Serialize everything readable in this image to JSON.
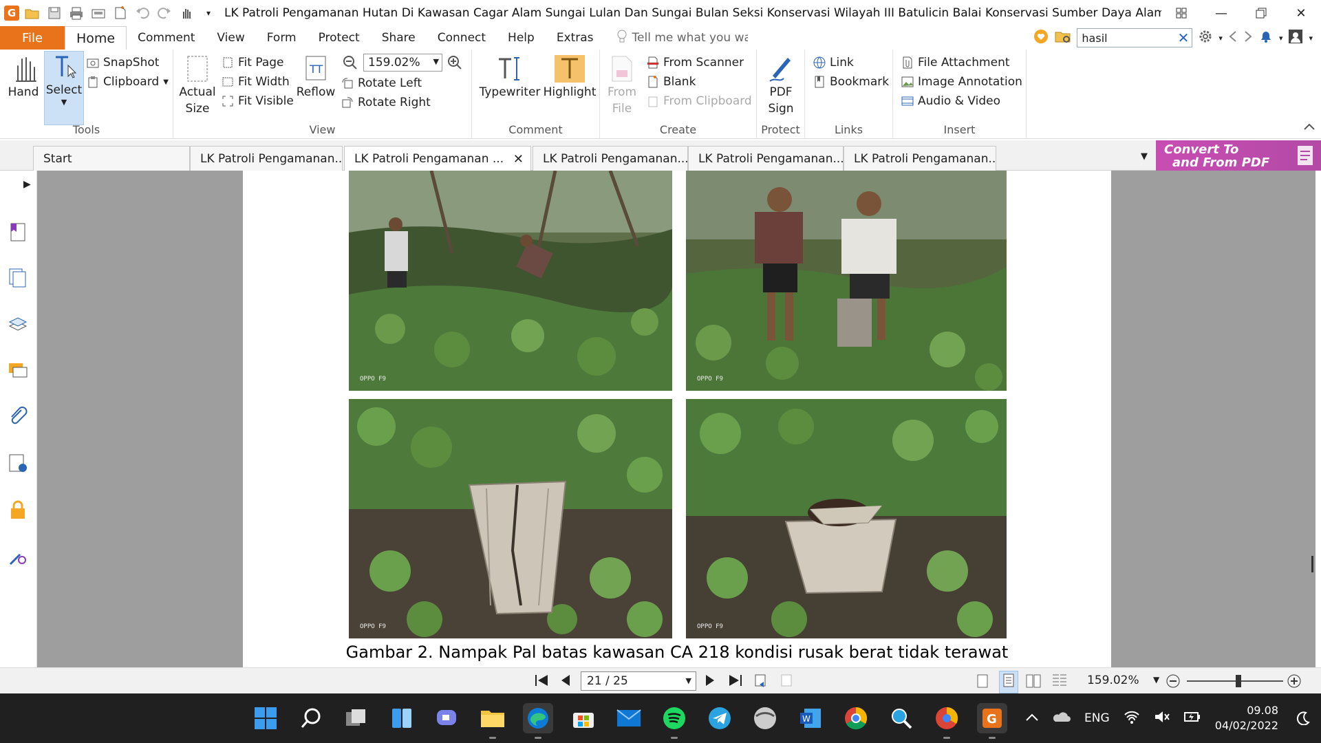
{
  "window": {
    "title": "LK Patroli Pengamanan Hutan Di Kawasan Cagar Alam Sungai Lulan Dan Sungai Bulan Seksi Konservasi Wilayah III Batulicin Balai Konservasi Sumber Daya Alam Kalimanta...",
    "app_logo": "G"
  },
  "menu": {
    "file": "File",
    "tabs": [
      "Home",
      "Comment",
      "View",
      "Form",
      "Protect",
      "Share",
      "Connect",
      "Help",
      "Extras"
    ],
    "tell_me": "Tell me what you wa",
    "search_value": "hasil"
  },
  "ribbon": {
    "tools": {
      "label": "Tools",
      "hand": "Hand",
      "select": "Select",
      "snapshot": "SnapShot",
      "clipboard": "Clipboard"
    },
    "view": {
      "label": "View",
      "actual_size_1": "Actual",
      "actual_size_2": "Size",
      "fit_page": "Fit Page",
      "fit_width": "Fit Width",
      "fit_visible": "Fit Visible",
      "reflow": "Reflow",
      "zoom": "159.02%",
      "rotate_left": "Rotate Left",
      "rotate_right": "Rotate Right"
    },
    "comment": {
      "label": "Comment",
      "typewriter": "Typewriter",
      "highlight": "Highlight"
    },
    "create": {
      "label": "Create",
      "from_file_1": "From",
      "from_file_2": "File",
      "from_scanner": "From Scanner",
      "blank": "Blank",
      "from_clipboard": "From Clipboard"
    },
    "protect": {
      "label": "Protect",
      "pdf_sign_1": "PDF",
      "pdf_sign_2": "Sign"
    },
    "links": {
      "label": "Links",
      "link": "Link",
      "bookmark": "Bookmark"
    },
    "insert": {
      "label": "Insert",
      "file_attachment": "File Attachment",
      "image_annotation": "Image Annotation",
      "audio_video": "Audio & Video"
    }
  },
  "doc_tabs": [
    "Start",
    "LK Patroli Pengamanan...",
    "LK Patroli Pengamanan ...",
    "LK Patroli Pengamanan...",
    "LK Patroli Pengamanan...",
    "LK Patroli Pengamanan..."
  ],
  "convert_banner": {
    "line1": "Convert To",
    "line2": "and From PDF"
  },
  "document": {
    "photo_tag": "OPPO F9",
    "caption": "Gambar 2. Nampak Pal batas kawasan CA 218 kondisi rusak berat tidak terawat"
  },
  "status": {
    "page": "21 / 25",
    "zoom": "159.02%"
  },
  "taskbar": {
    "lang": "ENG",
    "time": "09.08",
    "date": "04/02/2022"
  },
  "colors": {
    "accent": "#e8731a",
    "banner": "#c84db3",
    "taskbar": "#202020"
  }
}
